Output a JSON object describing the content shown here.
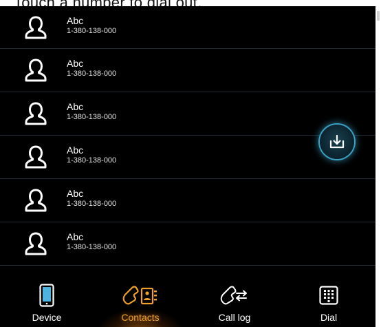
{
  "header": {
    "hint": "Touch a number to dial out."
  },
  "contacts": [
    {
      "name": "Abc",
      "number": "1-380-138-000"
    },
    {
      "name": "Abc",
      "number": "1-380-138-000"
    },
    {
      "name": "Abc",
      "number": "1-380-138-000"
    },
    {
      "name": "Abc",
      "number": "1-380-138-000"
    },
    {
      "name": "Abc",
      "number": "1-380-138-000"
    },
    {
      "name": "Abc",
      "number": "1-380-138-000"
    }
  ],
  "icons": {
    "contact": "person-outline-icon",
    "import": "download-tray-icon",
    "device": "phone-device-icon",
    "contacts": "handset-contact-card-icon",
    "call_log": "handset-arrows-icon",
    "dial": "keypad-icon"
  },
  "nav": {
    "tabs": [
      {
        "label": "Device"
      },
      {
        "label": "Contacts"
      },
      {
        "label": "Call log"
      },
      {
        "label": "Dial"
      }
    ],
    "active": "Contacts"
  },
  "colors": {
    "background": "#000000",
    "accent_active": "#f0a12a",
    "import_glow": "#3aa2c4",
    "text": "#ffffff"
  }
}
